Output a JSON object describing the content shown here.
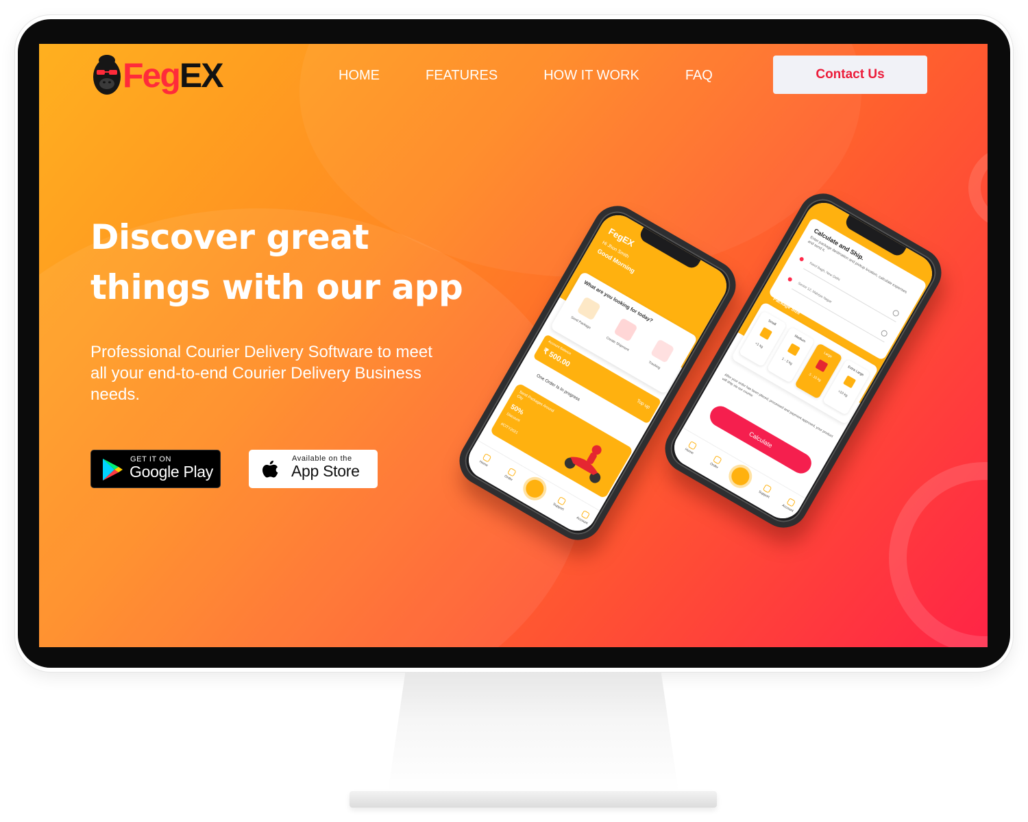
{
  "brand": {
    "name_part1": "Feg",
    "name_part2": "EX",
    "primary_color": "#ff2b3a",
    "dark_color": "#121212",
    "mascot_icon": "gorilla-mascot-icon"
  },
  "nav": {
    "items": [
      "HOME",
      "FEATURES",
      "HOW IT WORK",
      "FAQ"
    ]
  },
  "header": {
    "contact_label": "Contact Us",
    "contact_color": "#ec1c3a"
  },
  "hero": {
    "title_line1": "Discover great",
    "title_line2": "things with our app",
    "description": "Professional Courier Delivery Software to meet all your end-to-end Courier Delivery Business needs.",
    "gradient_colors": [
      "#ffb01f",
      "#ff5a30",
      "#ff2446"
    ]
  },
  "stores": {
    "google": {
      "small": "GET IT ON",
      "big": "Google Play",
      "icon": "google-play-icon"
    },
    "apple": {
      "small": "Available on the",
      "big": "App Store",
      "icon": "apple-icon"
    }
  },
  "phone_home": {
    "brand": "FegEX",
    "user": "Hi Jhon Smith",
    "greeting": "Good Morning",
    "question": "What are you looking for today?",
    "tiles": [
      "Send Package",
      "Create Shipment",
      "Tracking"
    ],
    "balance_label": "Account Balance",
    "balance_value": "₹ 500.00",
    "topup": "Top up",
    "order_status": "One Order Is In progress",
    "promo_text": "Send Packages Around City",
    "promo_value": "50%",
    "promo_label": "Discount",
    "promo_code": "#CITY2021",
    "tabs": [
      "Home",
      "Order",
      "Support",
      "Account"
    ]
  },
  "phone_calc": {
    "title": "Calculate and Ship.",
    "subtitle": "Enter package destination and pickup location, calculate expenses and send it.",
    "from": "Karol Bagh, New Delhi",
    "to": "Sector 12, Malviya Nagar",
    "size_title": "Package Size",
    "sizes": [
      {
        "name": "Small",
        "weight": "<1 kg"
      },
      {
        "name": "Medium",
        "weight": "1 - 3 kg"
      },
      {
        "name": "Large",
        "weight": "3 - 10 kg"
      },
      {
        "name": "Extra Large",
        "weight": ">10 kg"
      }
    ],
    "note": "After your order has been placed, processed and payment approved, your product will ship via our courier.",
    "button": "Calculate",
    "tabs": [
      "Home",
      "Order",
      "Support",
      "Account"
    ]
  }
}
